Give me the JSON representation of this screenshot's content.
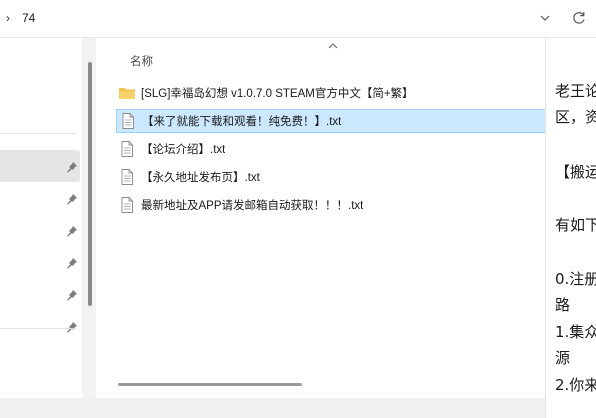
{
  "address_bar": {
    "chevron": "›",
    "path": "74",
    "dropdown_icon": "chevron-down-icon",
    "refresh_icon": "refresh-icon"
  },
  "file_list": {
    "column_name": "名称",
    "rows": [
      {
        "name": "[SLG]幸福岛幻想  v1.0.7.0  STEAM官方中文【简+繁】",
        "type": "folder"
      },
      {
        "name": "【来了就能下载和观看！纯免费！】.txt",
        "type": "text",
        "selected": true
      },
      {
        "name": "【论坛介绍】.txt",
        "type": "text"
      },
      {
        "name": "【永久地址发布页】.txt",
        "type": "text"
      },
      {
        "name": "最新地址及APP请发邮箱自动获取！！！.txt",
        "type": "text"
      }
    ]
  },
  "preview": {
    "lines": [
      "老王论",
      "区，资",
      "【搬运",
      "有如下",
      "0.注册",
      "路",
      "1.集众",
      "源",
      "2.你来"
    ]
  },
  "colors": {
    "selection_bg": "#cce8ff",
    "selection_border": "#99d1ff",
    "folder": "#f0c44c",
    "nav_selected": "#e5e5e5"
  }
}
